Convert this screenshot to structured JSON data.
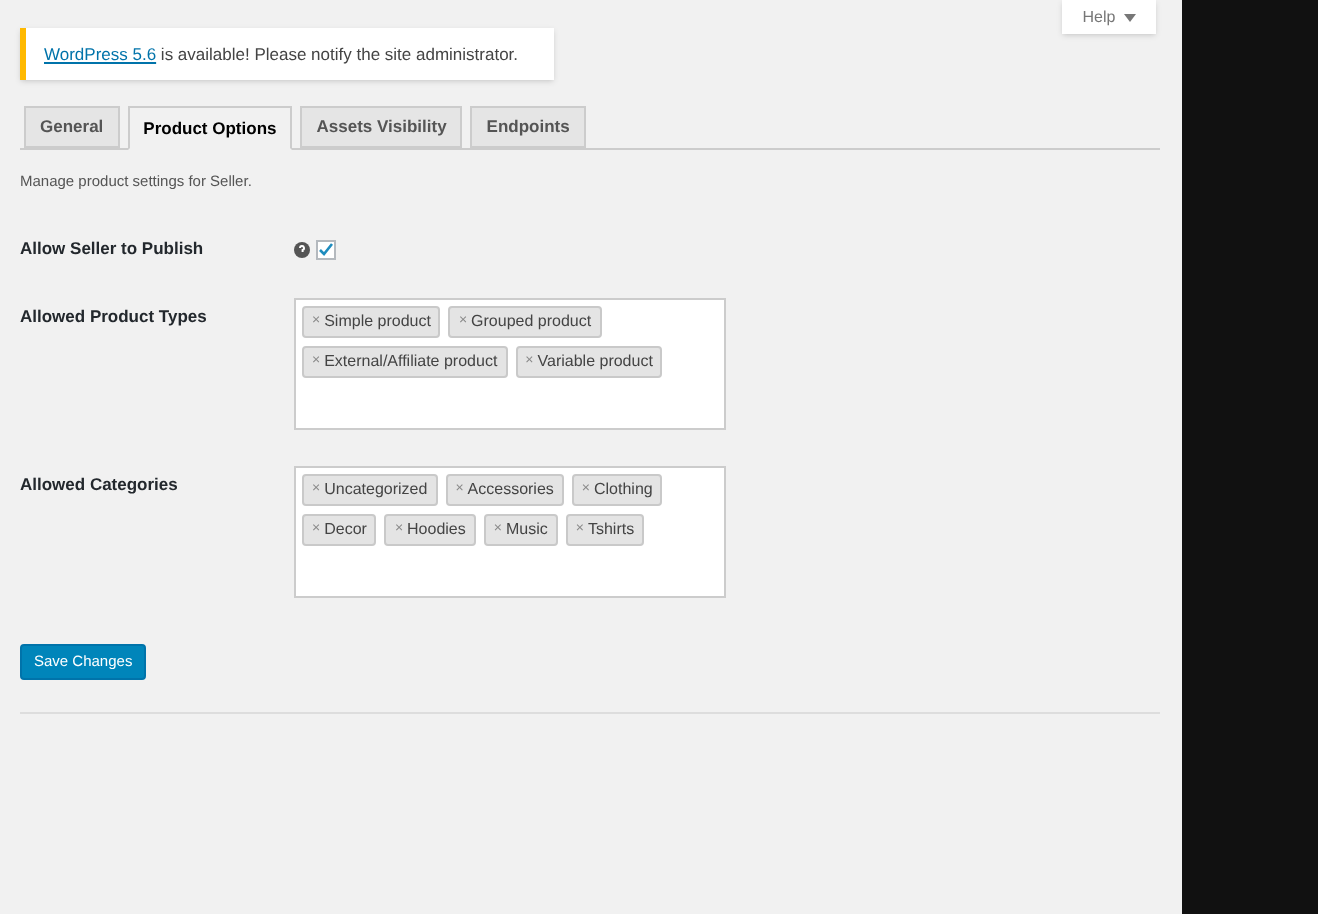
{
  "help_button": {
    "label": "Help"
  },
  "notice": {
    "link": "WordPress 5.6",
    "text": " is available! Please notify the site administrator."
  },
  "tabs": [
    {
      "label": "General",
      "selected": false
    },
    {
      "label": "Product Options",
      "selected": true
    },
    {
      "label": "Assets Visibility",
      "selected": false
    },
    {
      "label": "Endpoints",
      "selected": false
    }
  ],
  "description": "Manage product settings for Seller.",
  "allow_publish": {
    "label": "Allow Seller to Publish",
    "checked": true
  },
  "product_types": {
    "label": "Allowed Product Types",
    "tags": [
      {
        "remove": "×",
        "label": "Simple product"
      },
      {
        "remove": "×",
        "label": "Grouped product"
      },
      {
        "remove": "×",
        "label": "External/Affiliate product"
      },
      {
        "remove": "×",
        "label": "Variable product"
      }
    ]
  },
  "categories": {
    "label": "Allowed Categories",
    "tags": [
      {
        "remove": "×",
        "label": "Uncategorized"
      },
      {
        "remove": "×",
        "label": "Accessories"
      },
      {
        "remove": "×",
        "label": "Clothing"
      },
      {
        "remove": "×",
        "label": "Decor"
      },
      {
        "remove": "×",
        "label": "Hoodies"
      },
      {
        "remove": "×",
        "label": "Music"
      },
      {
        "remove": "×",
        "label": "Tshirts"
      }
    ]
  },
  "save_button": {
    "label": "Save Changes"
  }
}
